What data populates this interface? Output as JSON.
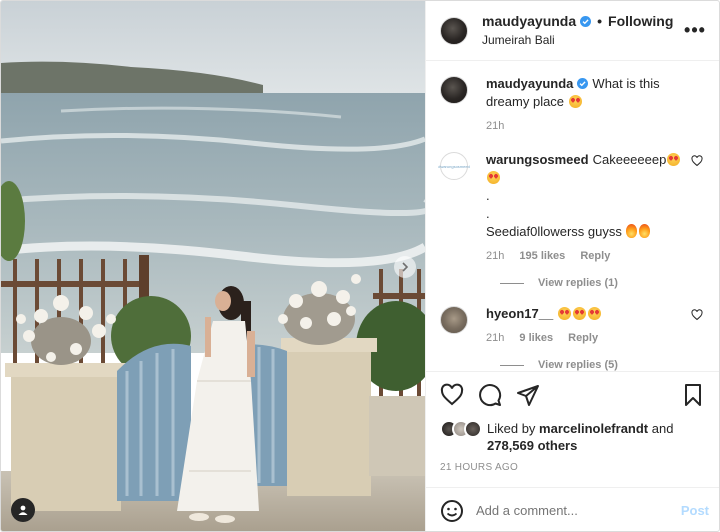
{
  "post": {
    "author": "maudyayunda",
    "separator": "•",
    "follow_label": "Following",
    "location": "Jumeirah Bali",
    "more_label": "•••"
  },
  "caption": {
    "user": "maudyayunda",
    "text": "What is this dreamy place",
    "time": "21h"
  },
  "comments": [
    {
      "user": "warungsosmeed",
      "avatar_text": "#warungsosmeed",
      "line1": "Cakeeeeeep",
      "line2": ".",
      "line3": ".",
      "line4": "Seediaf0llowerss guyss",
      "time": "21h",
      "likes": "195 likes",
      "reply": "Reply",
      "view_replies": "View replies (1)"
    },
    {
      "user": "hyeon17__",
      "time": "21h",
      "likes": "9 likes",
      "reply": "Reply",
      "view_replies": "View replies (5)"
    }
  ],
  "likes": {
    "prefix": "Liked by",
    "by_user": "marcelinolefrandt",
    "and": "and",
    "others": "278,569 others"
  },
  "timestamp": "21 HOURS AGO",
  "add_comment": {
    "placeholder": "Add a comment...",
    "post_label": "Post"
  },
  "colors": {
    "verified": "#3897f0",
    "post_disabled": "#b3dbff",
    "muted": "#8e8e8e"
  },
  "icons": {
    "like": "heart-icon",
    "comment": "comment-icon",
    "share": "paper-plane-icon",
    "save": "bookmark-icon",
    "emoji": "smiley-icon",
    "next": "chevron-right-icon",
    "tagged": "user-tag-icon"
  }
}
